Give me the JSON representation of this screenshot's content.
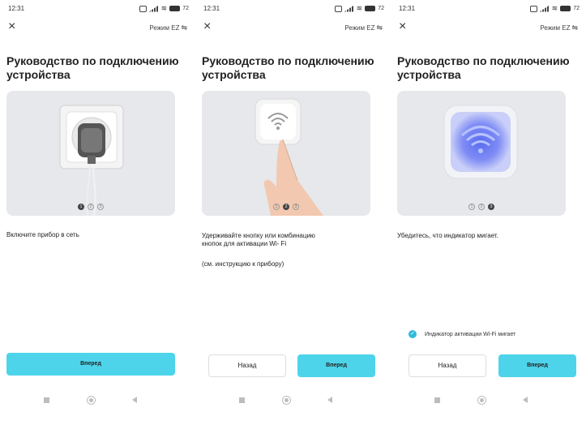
{
  "status_bar": {
    "time": "12:31",
    "battery": "72"
  },
  "header": {
    "mode_label": "Режим EZ",
    "title": "Руководство по подключению устройства"
  },
  "screens": [
    {
      "step_active": 1,
      "dots": [
        "1",
        "2",
        "3"
      ],
      "description_lines": [
        "Включите прибор в сеть"
      ],
      "next_label": "Вперед"
    },
    {
      "step_active": 2,
      "dots": [
        "1",
        "2",
        "3"
      ],
      "description_lines": [
        "Удерживайте кнопку или комбинацию",
        "кнопок для активации Wi- Fi",
        "(см. инструкцию к прибору)"
      ],
      "back_label": "Назад",
      "next_label": "Вперед"
    },
    {
      "step_active": 3,
      "dots": [
        "1",
        "2",
        "3"
      ],
      "description_lines": [
        "Убедитесь, что индикатор мигает."
      ],
      "checkbox_label": "Индикатор активации Wi-Fi мигает",
      "checkbox_checked": true,
      "back_label": "Назад",
      "next_label": "Вперед"
    }
  ],
  "colors": {
    "accent": "#4dd4ea",
    "check": "#32b9d9",
    "illustration_bg": "#e6e8ec"
  },
  "icons": [
    "close-icon",
    "switch-mode-icon",
    "signal-icon",
    "wifi-icon",
    "battery-icon",
    "power-outlet-illustration",
    "wifi-button-press-illustration",
    "wifi-indicator-glow-illustration",
    "check-icon",
    "recents-nav-icon",
    "home-nav-icon",
    "back-nav-icon"
  ]
}
